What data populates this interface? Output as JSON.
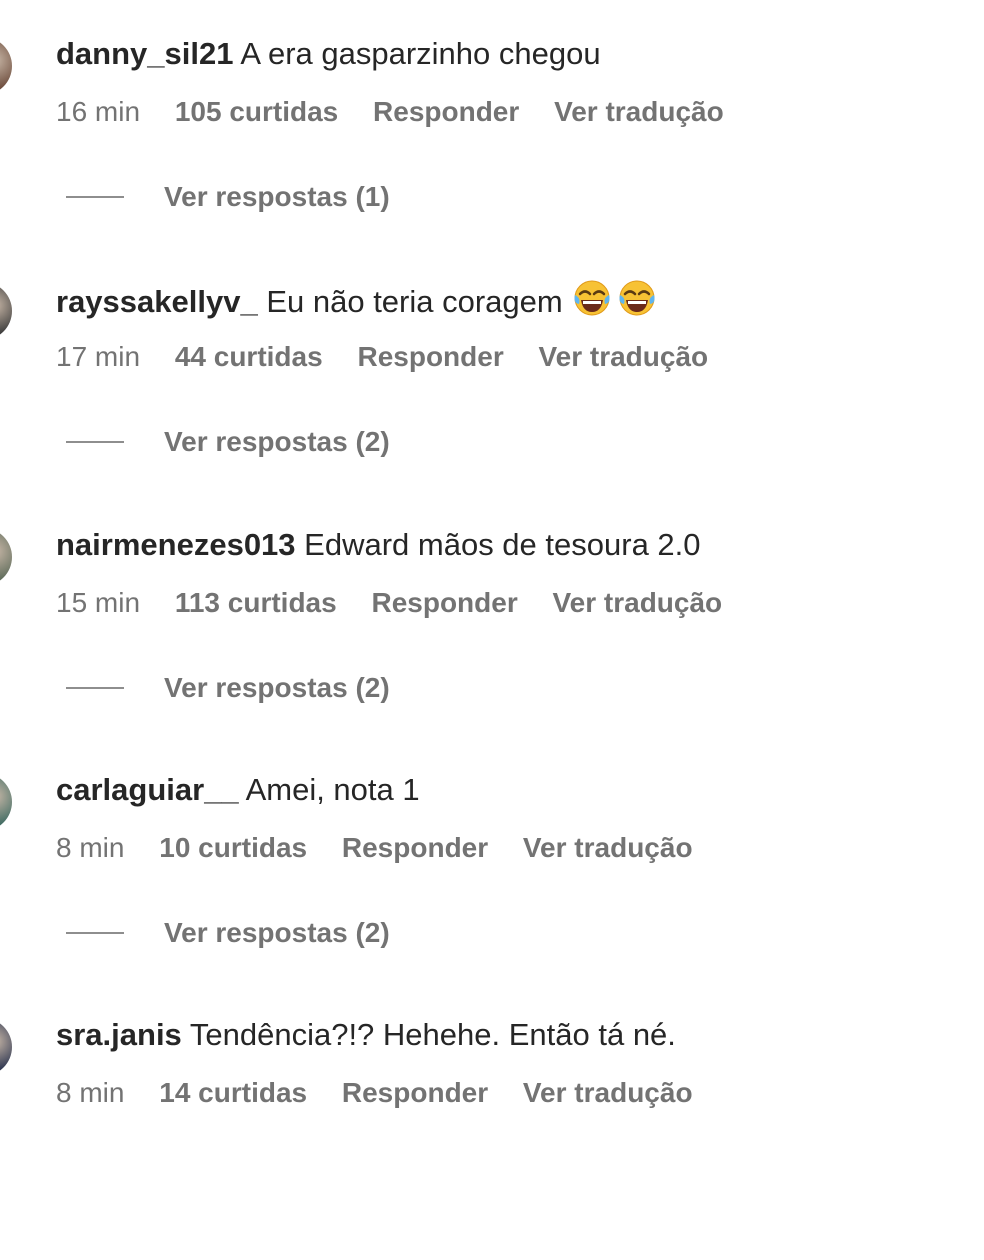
{
  "comments": [
    {
      "username": "danny_sil21",
      "text": "A era gasparzinho chegou",
      "time": "16 min",
      "likes": "105 curtidas",
      "reply": "Responder",
      "translate": "Ver tradução",
      "view_replies": "Ver respostas (1)",
      "avatar_color": "#6b4a3a"
    },
    {
      "username": "rayssakellyv_",
      "text": "Eu não teria coragem",
      "emojis": "😂😂",
      "time": "17 min",
      "likes": "44 curtidas",
      "reply": "Responder",
      "translate": "Ver tradução",
      "view_replies": "Ver respostas (2)",
      "avatar_color": "#3a3a3a"
    },
    {
      "username": "nairmenezes013",
      "text": "Edward mãos de tesoura 2.0",
      "time": "15 min",
      "likes": "113 curtidas",
      "reply": "Responder",
      "translate": "Ver tradução",
      "view_replies": "Ver respostas (2)",
      "avatar_color": "#5e6b5a"
    },
    {
      "username": "carlaguiar__",
      "text": "Amei, nota 1",
      "time": "8 min",
      "likes": "10 curtidas",
      "reply": "Responder",
      "translate": "Ver tradução",
      "view_replies": "Ver respostas (2)",
      "avatar_color": "#3f6b62"
    },
    {
      "username": "sra.janis",
      "text": "Tendência?!? Hehehe. Então tá né.",
      "time": "8 min",
      "likes": "14 curtidas",
      "reply": "Responder",
      "translate": "Ver tradução",
      "avatar_color": "#2c3550"
    }
  ]
}
